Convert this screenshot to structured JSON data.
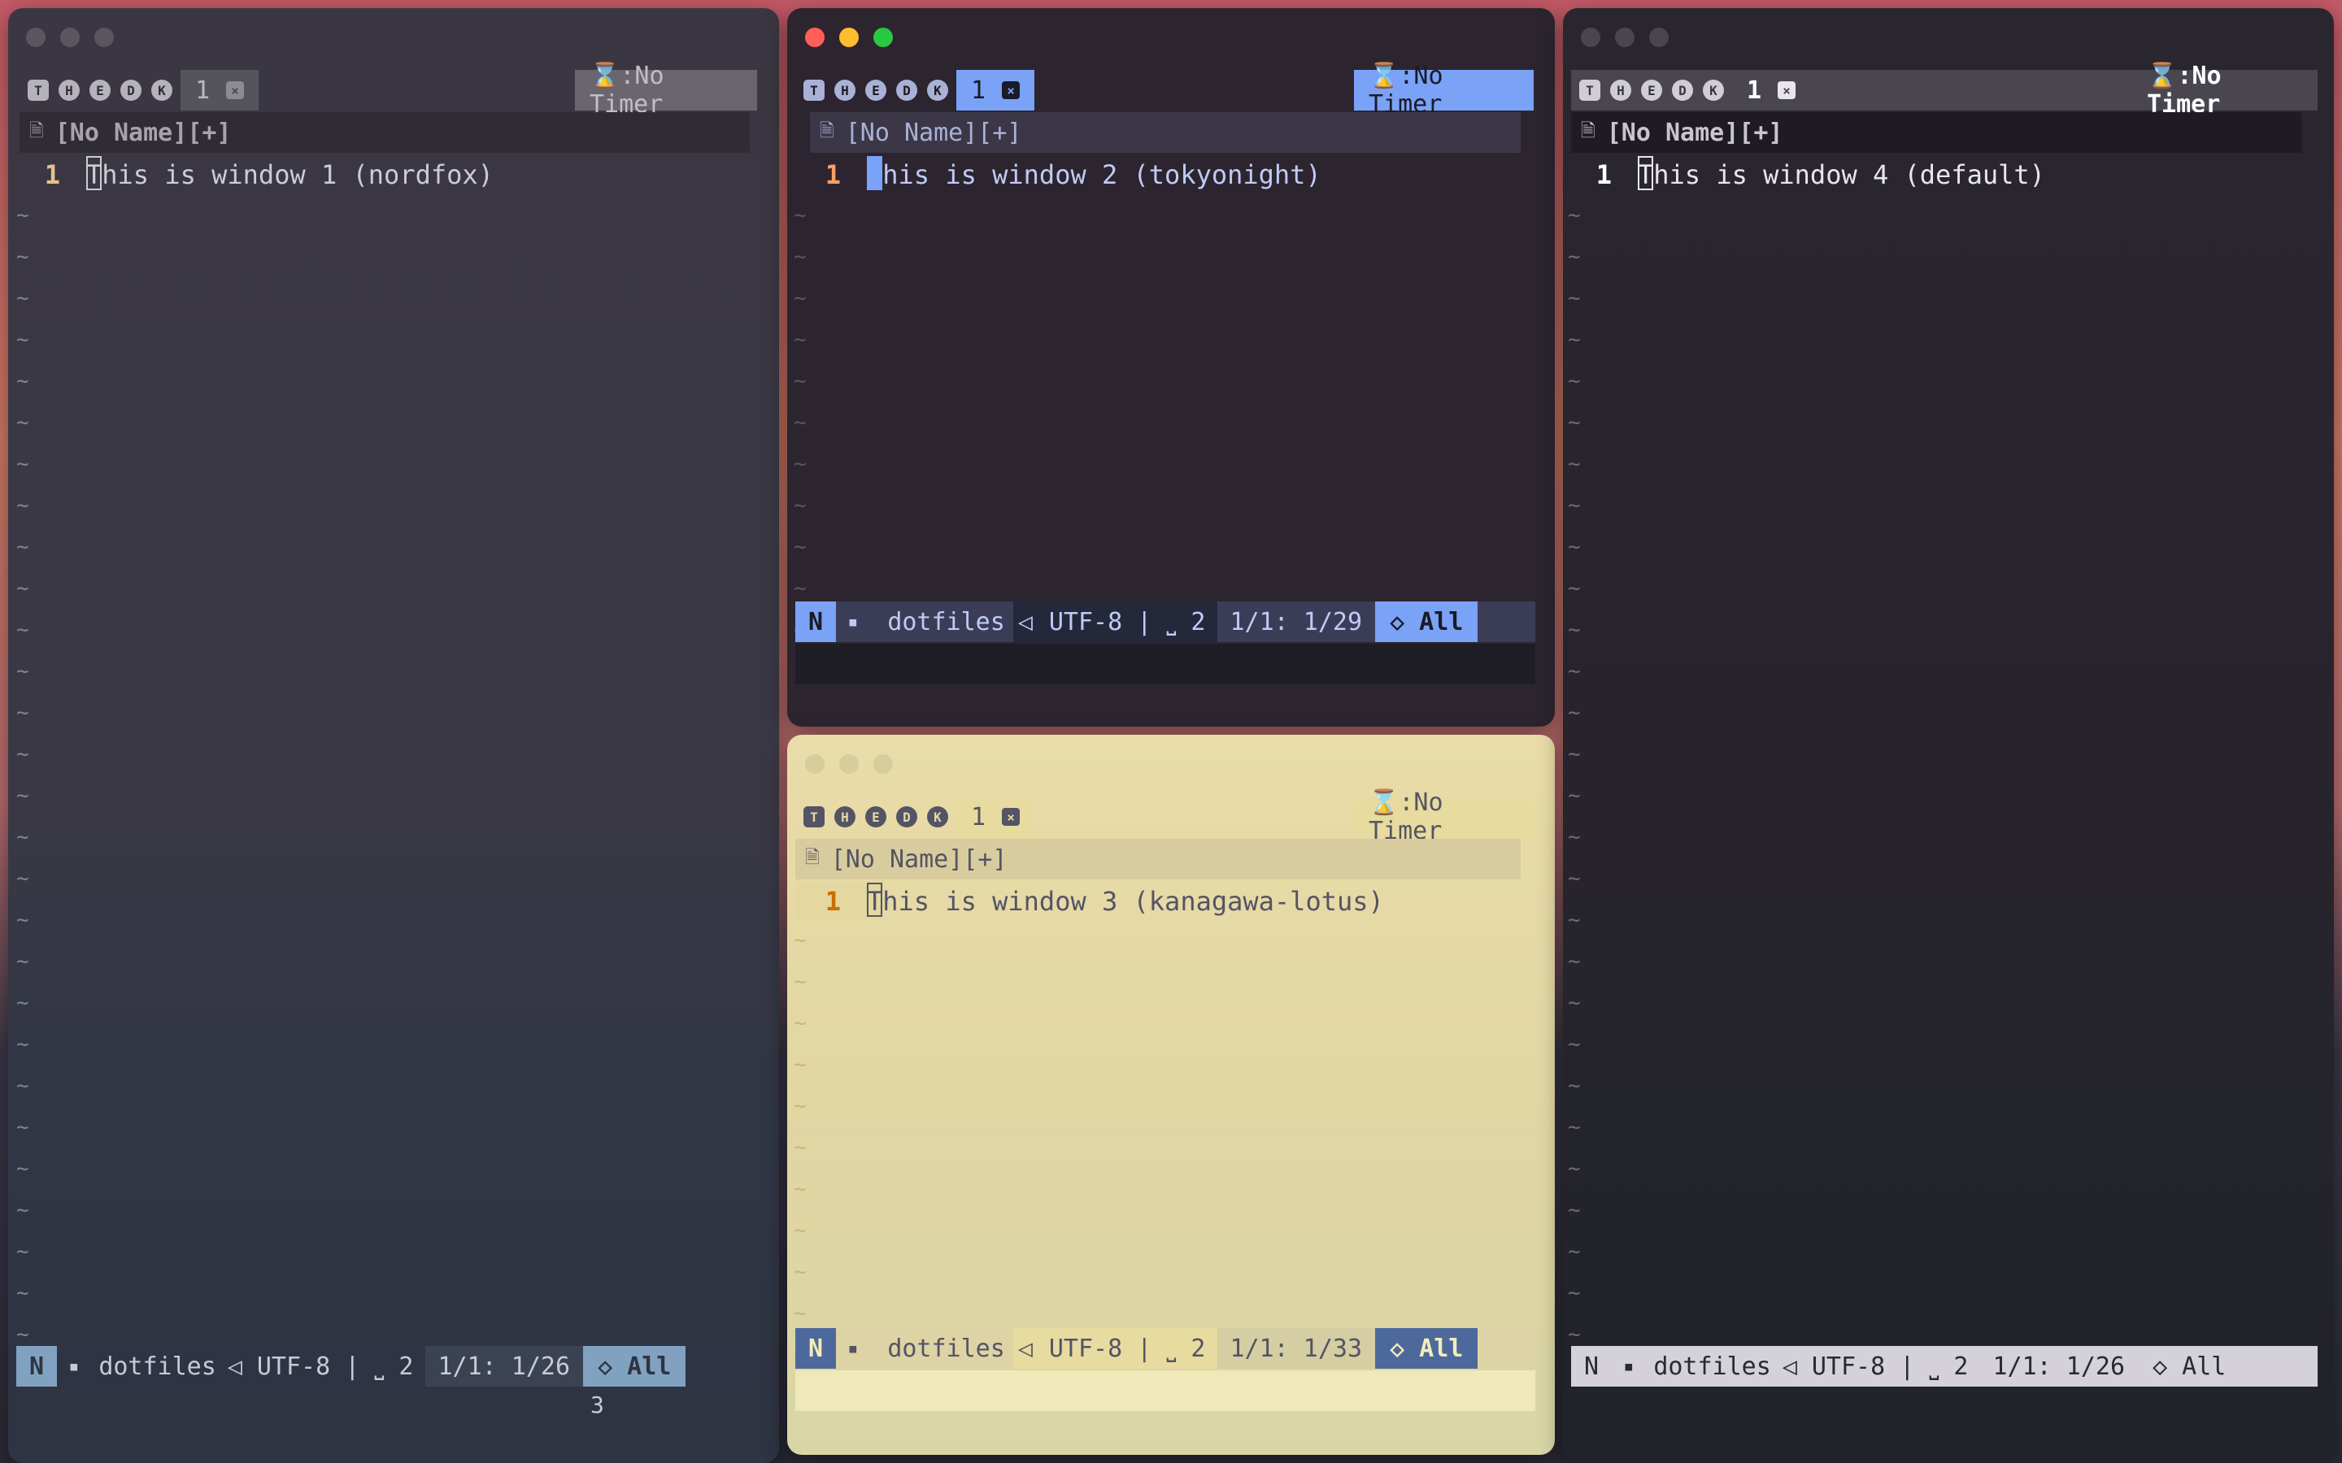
{
  "common": {
    "tab_number": "1",
    "tab_close": "×",
    "timer_label": "⌛:No Timer",
    "file_name": "[No Name][+]",
    "mode": "N",
    "cwd_icon": "▪",
    "cwd": "dotfiles",
    "sep": "◁",
    "encoding": "UTF-8 | ⎵ 2",
    "scroll": "◇ All",
    "tab_icons": [
      "T",
      "H",
      "E",
      "D",
      "K"
    ],
    "tilde": "~"
  },
  "windows": [
    {
      "id": "win1",
      "theme": "nordfox",
      "line_number": "1",
      "text": "This is window 1 (nordfox)",
      "position": "1/1: 1/26",
      "active": false
    },
    {
      "id": "win2",
      "theme": "tokyonight",
      "line_number": "1",
      "text": "This is window 2 (tokyonight)",
      "position": "1/1: 1/29",
      "active": true
    },
    {
      "id": "win3",
      "theme": "kanagawa-lotus",
      "line_number": "1",
      "text": "This is window 3 (kanagawa-lotus)",
      "position": "1/1: 1/33",
      "active": false
    },
    {
      "id": "win4",
      "theme": "default",
      "line_number": "1",
      "text": "This is window 4 (default)",
      "position": "1/1: 1/26",
      "active": false
    }
  ],
  "stray_text": "3",
  "colors": {
    "close": "#fe5f57",
    "minimize": "#febc2e",
    "zoom": "#28c840",
    "nordfox_bg": "#353543",
    "tokyonight_bg": "#2c2530",
    "kanagawa_bg": "#e6d9a6",
    "default_bg": "#232028"
  }
}
